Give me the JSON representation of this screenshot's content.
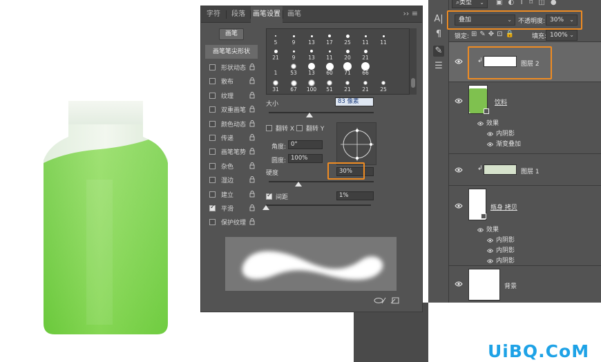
{
  "brush_panel": {
    "tabs": [
      "字符",
      "段落",
      "画笔设置",
      "画笔"
    ],
    "active_tab": "画笔设置",
    "brushes_button": "画笔",
    "tip_shape": "画笔笔尖形状",
    "options": [
      {
        "label": "形状动态",
        "checked": false
      },
      {
        "label": "散布",
        "checked": false
      },
      {
        "label": "纹理",
        "checked": false
      },
      {
        "label": "双重画笔",
        "checked": false
      },
      {
        "label": "颜色动态",
        "checked": false
      },
      {
        "label": "传递",
        "checked": false
      },
      {
        "label": "画笔笔势",
        "checked": false
      },
      {
        "label": "杂色",
        "checked": false
      },
      {
        "label": "湿边",
        "checked": false
      },
      {
        "label": "建立",
        "checked": false
      },
      {
        "label": "平滑",
        "checked": true
      },
      {
        "label": "保护纹理",
        "checked": false
      }
    ],
    "brush_sizes": [
      [
        "5",
        "9",
        "13",
        "17",
        "25",
        "11",
        "11"
      ],
      [
        "21",
        "9",
        "13",
        "11",
        "20",
        "21",
        ""
      ],
      [
        "1",
        "53",
        "13",
        "60",
        "71",
        "66",
        "",
        ""
      ],
      [
        "31",
        "67",
        "100",
        "51",
        "21",
        "21",
        "25"
      ]
    ],
    "size_label": "大小",
    "size_value": "83 像素",
    "flip_x": "翻转 X",
    "flip_y": "翻转 Y",
    "angle_label": "角度:",
    "angle_value": "0°",
    "roundness_label": "圆度:",
    "roundness_value": "100%",
    "hardness_label": "硬度",
    "hardness_value": "30%",
    "spacing_label": "间距",
    "spacing_value": "1%",
    "spacing_checked": true
  },
  "layers_panel": {
    "filter_label": "类型",
    "blend_mode": "叠加",
    "opacity_label": "不透明度:",
    "opacity_value": "30%",
    "lock_label": "锁定:",
    "fill_label": "填充:",
    "fill_value": "100%",
    "layers": [
      {
        "name": "图层 2",
        "selected": true
      },
      {
        "name": "饮料",
        "selected": false,
        "effects_label": "效果",
        "effects": [
          "内阴影",
          "渐变叠加"
        ]
      },
      {
        "name": "图层 1",
        "selected": false
      },
      {
        "name": "瓶身 拷贝",
        "selected": false,
        "effects_label": "效果",
        "effects": [
          "内阴影",
          "内阴影",
          "内阴影"
        ]
      },
      {
        "name": "背景",
        "selected": false
      }
    ]
  },
  "watermark": "UiBQ.CoM",
  "colors": {
    "highlight": "#f08c22",
    "panel_bg": "#535353",
    "bottle_green": "#7fd34e",
    "watermark": "#1ea2e6"
  }
}
